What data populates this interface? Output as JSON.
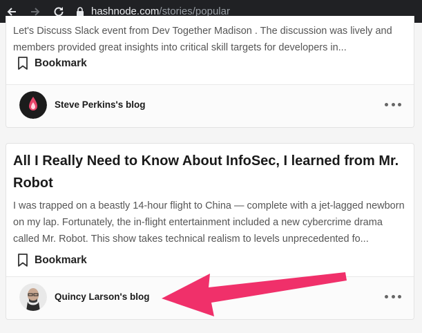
{
  "browser": {
    "url_domain": "hashnode.com",
    "url_path": "/stories/popular",
    "icons": [
      "back-arrow-icon",
      "forward-arrow-icon",
      "reload-icon",
      "lock-icon"
    ]
  },
  "stories": [
    {
      "excerpt": "Let's Discuss Slack event from Dev Together Madison . The discussion was lively and members provided great insights into critical skill targets for developers in...",
      "bookmark_label": "Bookmark",
      "blog_name": "Steve Perkins's blog"
    },
    {
      "title": "All I Really Need to Know About InfoSec, I learned from Mr. Robot",
      "excerpt": "I was trapped on a beastly 14-hour flight to China — complete with a jet-lagged newborn on my lap. Fortunately, the in-flight entertainment included a new cybercrime drama called Mr. Robot. This show takes technical realism to levels unprecedented fo...",
      "bookmark_label": "Bookmark",
      "blog_name": "Quincy Larson's blog"
    }
  ],
  "colors": {
    "toolbar": "#202124",
    "annotation_arrow": "#f0306a",
    "page_bg": "#f5f5f5"
  }
}
